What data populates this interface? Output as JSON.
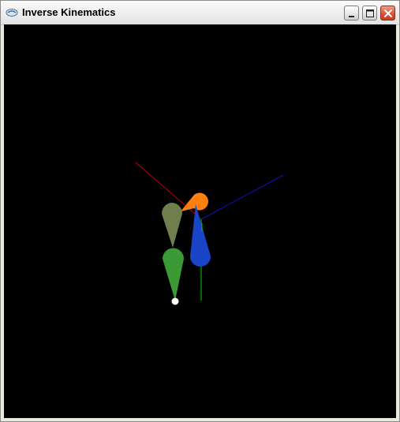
{
  "window": {
    "title": "Inverse Kinematics",
    "app_icon": "opengl-window-icon",
    "controls": {
      "minimize_icon": "minimize-icon",
      "maximize_icon": "maximize-icon",
      "close_icon": "close-icon"
    }
  },
  "scene": {
    "background_color": "#000000",
    "axis_colors": {
      "x": "#c00000",
      "y": "#00d000",
      "z": "#1010c0"
    },
    "limb_colors": {
      "left_thigh": "#6e7f4d",
      "left_shin": "#3a9a35",
      "right_thigh": "#ff7f10",
      "right_shin": "#1a44c8",
      "ik_target": "#ffffff"
    }
  }
}
